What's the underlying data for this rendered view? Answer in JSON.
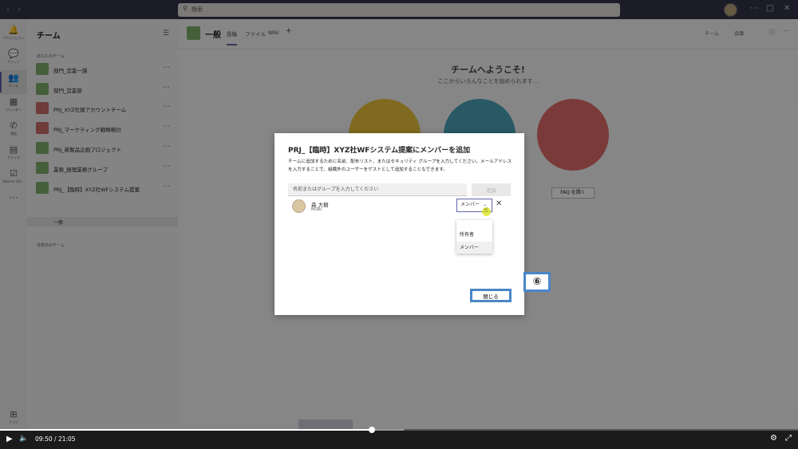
{
  "search": {
    "placeholder": "検索"
  },
  "rail": {
    "items": [
      {
        "label": "アクティビティ",
        "icon": "bell-icon"
      },
      {
        "label": "チャット",
        "icon": "chat-icon"
      },
      {
        "label": "チーム",
        "icon": "teams-icon"
      },
      {
        "label": "カレンダー",
        "icon": "calendar-icon"
      },
      {
        "label": "通話",
        "icon": "phone-icon"
      },
      {
        "label": "ファイル",
        "icon": "file-icon"
      },
      {
        "label": "Planner (for...",
        "icon": "planner-icon"
      },
      {
        "label": "アプリ",
        "icon": "apps-icon"
      }
    ]
  },
  "teams_panel": {
    "title": "チーム",
    "your_teams_label": "あなたのチーム",
    "hidden_teams_label": "非表示のチーム",
    "teams": [
      {
        "name": "部門_営業一課"
      },
      {
        "name": "部門_営業部"
      },
      {
        "name": "PRJ_XYZ社様アカウントチーム"
      },
      {
        "name": "PRJ_マーケティング戦略検討"
      },
      {
        "name": "PRJ_新製品企画プロジェクト"
      },
      {
        "name": "業務_経理業務グループ"
      },
      {
        "name": "PRJ_【臨時】XYZ社WFシステム提案"
      }
    ],
    "channel": "一般"
  },
  "main": {
    "channel_title": "一般",
    "tabs": [
      "投稿",
      "ファイル",
      "Wiki"
    ],
    "add_tab": "+",
    "header_buttons": [
      "チーム",
      "会議"
    ],
    "welcome_title": "チームへようこそ!",
    "welcome_sub": "ここからいろんなことを始められます...",
    "faq_label": "FAQ を開く"
  },
  "dialog": {
    "title": "PRJ_【臨時】XYZ社WFシステム提案にメンバーを追加",
    "description": "チームに追加するために名前、配布リスト、またはセキュリティ グループを入力してください。メールアドレスを入力することで、組織外のユーザーをゲストとして追加することもできます。",
    "input_placeholder": "名前またはグループを入力してください",
    "add_label": "追加",
    "member": {
      "name": "森 大樹",
      "id": "MORI"
    },
    "role_selected": "メンバー",
    "role_options": [
      "所有者",
      "メンバー"
    ],
    "close_label": "閉じる"
  },
  "annotation": {
    "step": "⑥"
  },
  "player": {
    "current_time": "09:50",
    "separator": "/",
    "duration": "21:05",
    "progress": 0.466,
    "buffered": 0.506
  }
}
